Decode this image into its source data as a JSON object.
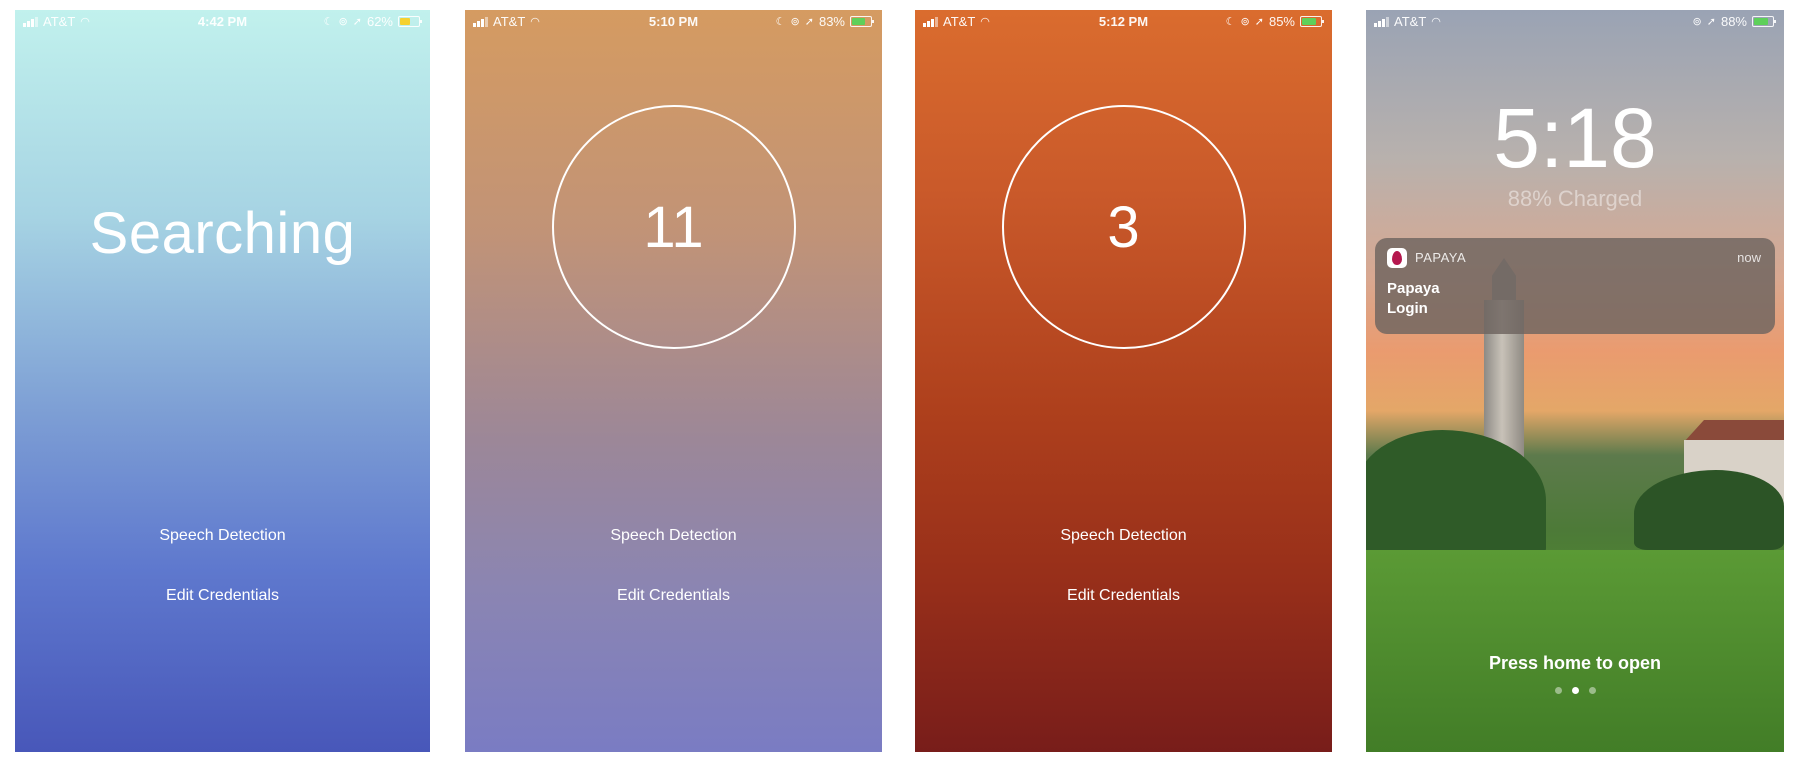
{
  "screens": [
    {
      "status": {
        "carrier": "AT&T",
        "time": "4:42 PM",
        "battery": "62%",
        "battery_level": 0.62,
        "battery_color": "#f5d130"
      },
      "main_text": "Searching",
      "buttons": {
        "speech": "Speech Detection",
        "credentials": "Edit Credentials"
      }
    },
    {
      "status": {
        "carrier": "AT&T",
        "time": "5:10 PM",
        "battery": "83%",
        "battery_level": 0.83,
        "battery_color": "#5ed05a"
      },
      "counter": "11",
      "buttons": {
        "speech": "Speech Detection",
        "credentials": "Edit Credentials"
      }
    },
    {
      "status": {
        "carrier": "AT&T",
        "time": "5:12 PM",
        "battery": "85%",
        "battery_level": 0.85,
        "battery_color": "#5ed05a"
      },
      "counter": "3",
      "buttons": {
        "speech": "Speech Detection",
        "credentials": "Edit Credentials"
      }
    },
    {
      "status": {
        "carrier": "AT&T",
        "battery": "88%",
        "battery_level": 0.88,
        "battery_color": "#5ed05a"
      },
      "lock_time": "5:18",
      "charge_text": "88% Charged",
      "notification": {
        "app": "PAPAYA",
        "time": "now",
        "title": "Papaya",
        "body": "Login",
        "icon": "papaya-app-icon"
      },
      "press_home": "Press home to open",
      "page_dots": 3,
      "active_dot": 2
    }
  ],
  "icons": [
    "signal-icon",
    "wifi-icon",
    "moon-icon",
    "orientation-lock-icon",
    "location-arrow-icon",
    "battery-icon"
  ]
}
